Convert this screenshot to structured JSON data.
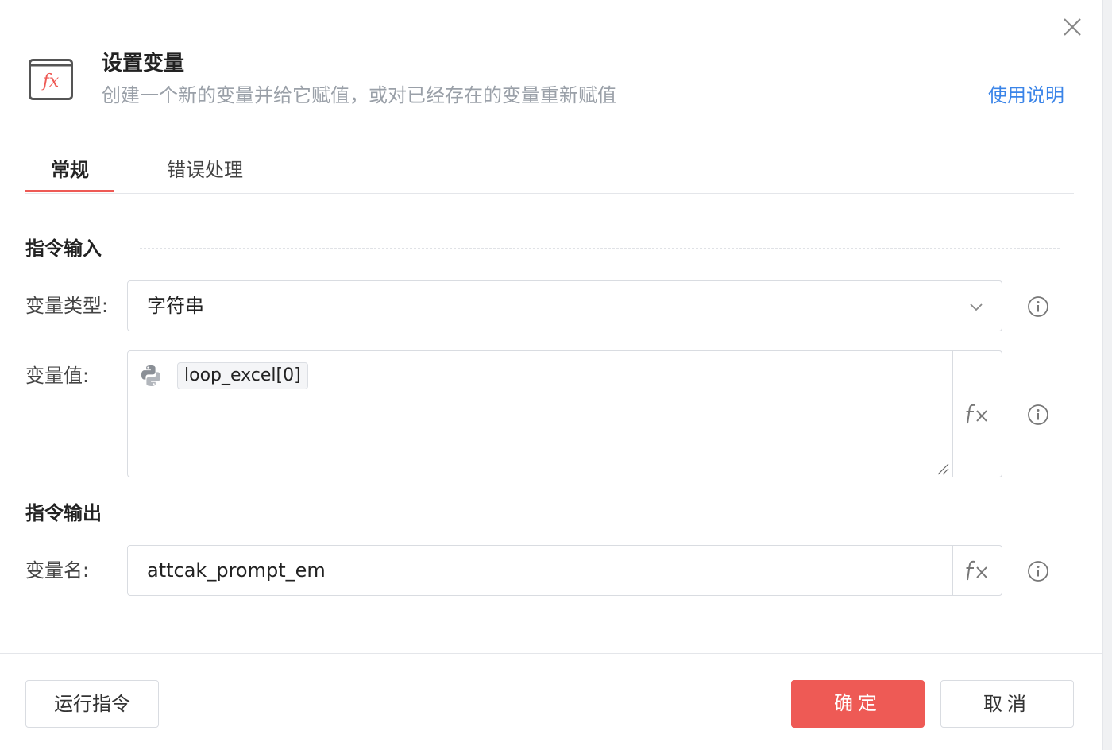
{
  "header": {
    "title": "设置变量",
    "subtitle": "创建一个新的变量并给它赋值，或对已经存在的变量重新赋值",
    "help_link": "使用说明",
    "icon_glyph": "fx"
  },
  "tabs": [
    {
      "label": "常规",
      "active": true
    },
    {
      "label": "错误处理",
      "active": false
    }
  ],
  "sections": {
    "input_title": "指令输入",
    "output_title": "指令输出"
  },
  "fields": {
    "var_type": {
      "label": "变量类型:",
      "value": "字符串"
    },
    "var_value": {
      "label": "变量值:",
      "token": "loop_excel[0]"
    },
    "var_name": {
      "label": "变量名:",
      "value": "attcak_prompt_em"
    }
  },
  "footer": {
    "run_label": "运行指令",
    "ok_label": "确定",
    "cancel_label": "取消"
  },
  "colors": {
    "accent": "#ee5a55",
    "link": "#3a84e8",
    "muted_text": "#9aa0a8",
    "border": "#d9dce1"
  },
  "icons": {
    "close": "close-icon",
    "header": "function-icon",
    "chevron": "chevron-down-icon",
    "python": "python-icon",
    "fx": "fx-icon",
    "info": "info-icon",
    "resize": "resize-handle-icon"
  }
}
